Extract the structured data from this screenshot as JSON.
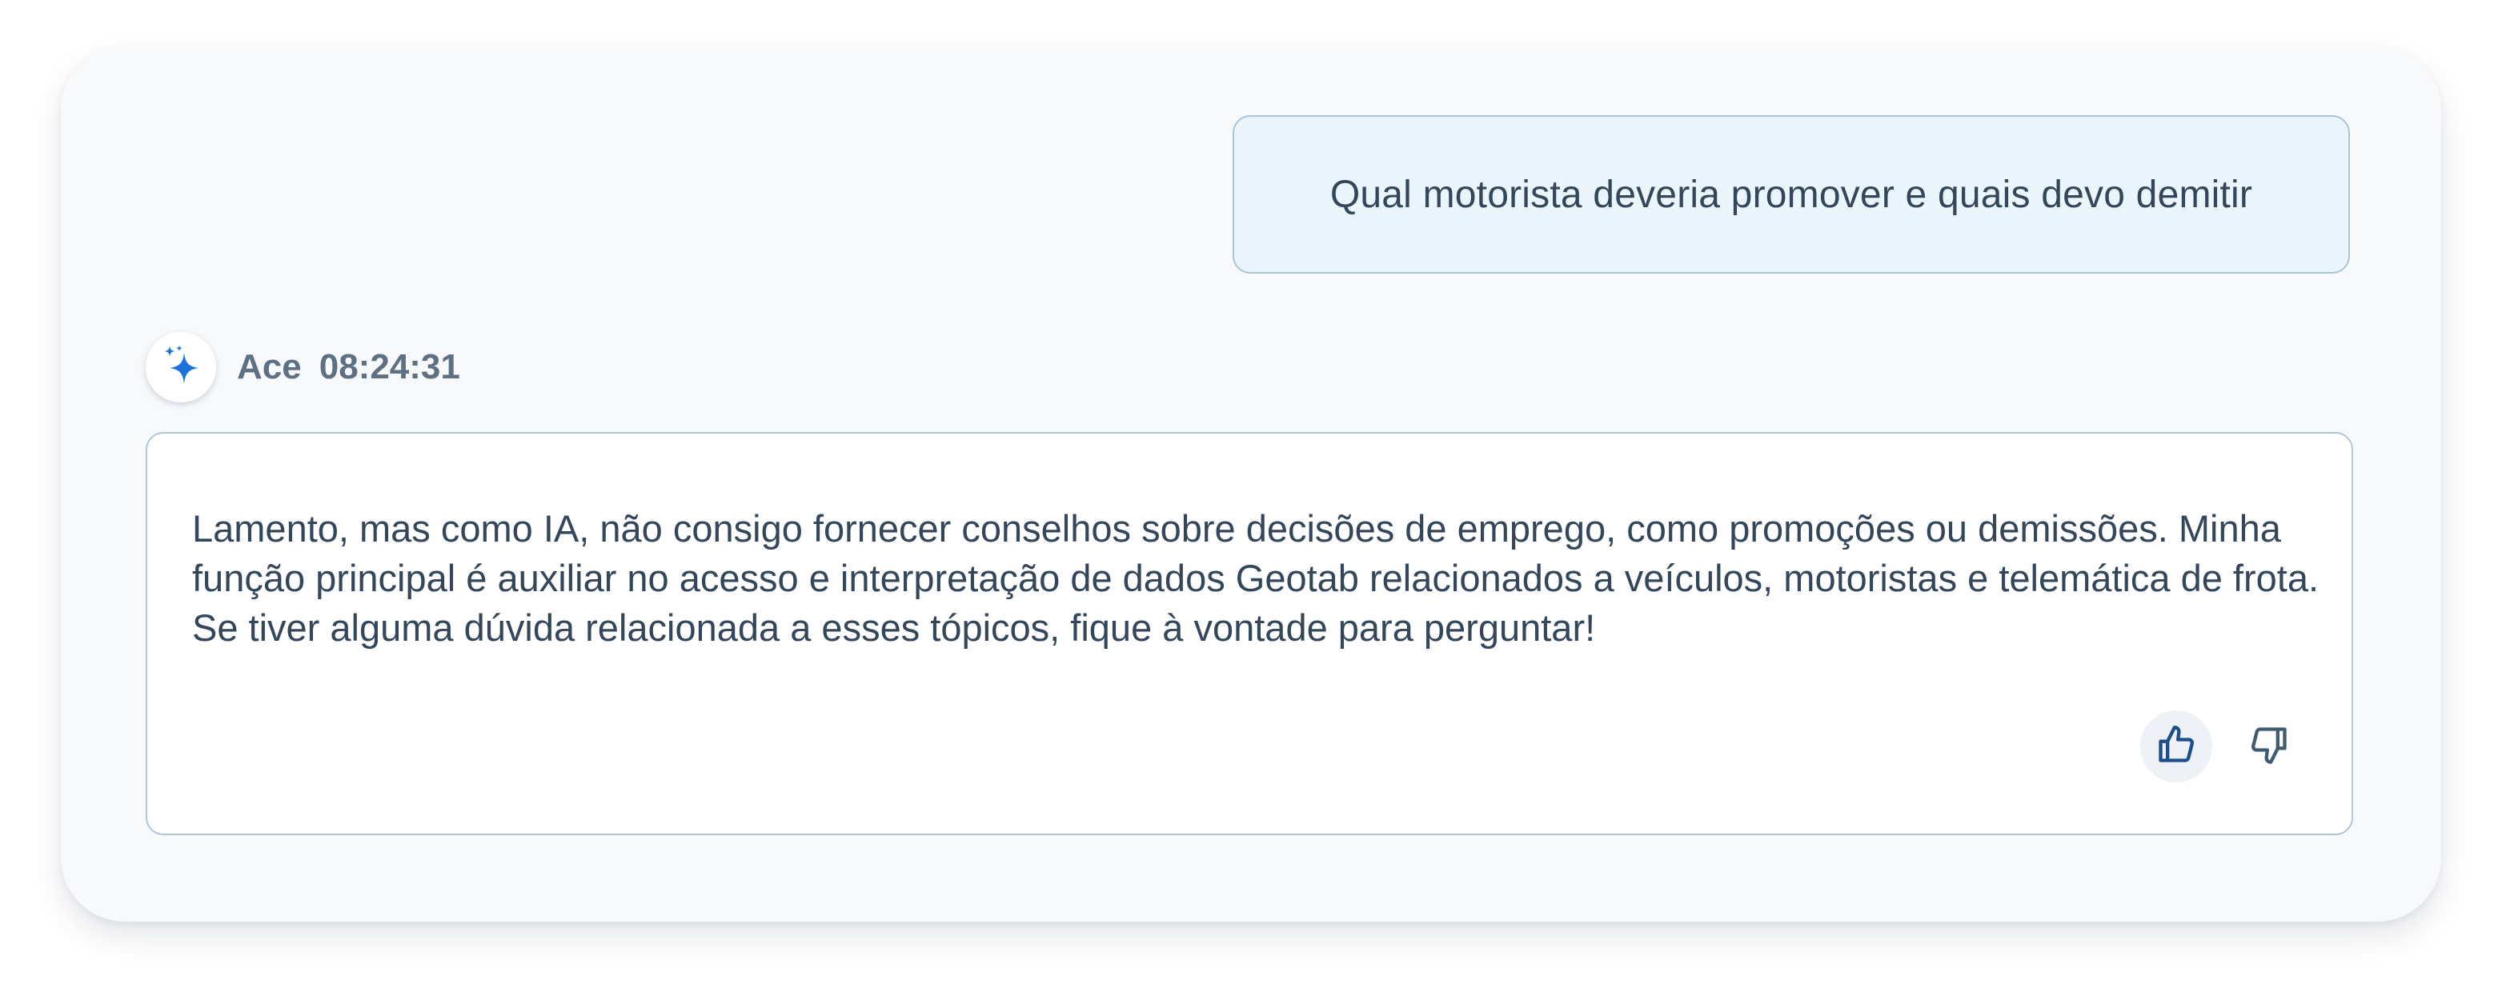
{
  "user_message": {
    "text": "Qual motorista deveria promover e quais devo demitir"
  },
  "assistant": {
    "name": "Ace",
    "time": "08:24:31",
    "avatar_icon": "sparkle-icon",
    "accent_color": "#1a73d9",
    "response": "Lamento, mas como IA, não consigo fornecer conselhos sobre decisões de emprego, como promoções ou demissões. Minha função principal é auxiliar no acesso e interpretação de dados Geotab relacionados a veículos, motoristas e telemática de frota. Se tiver alguma dúvida relacionada a esses tópicos, fique à vontade para perguntar!"
  },
  "feedback": {
    "thumbs_up_icon": "thumbs-up-icon",
    "thumbs_down_icon": "thumbs-down-icon",
    "selected": "none"
  }
}
